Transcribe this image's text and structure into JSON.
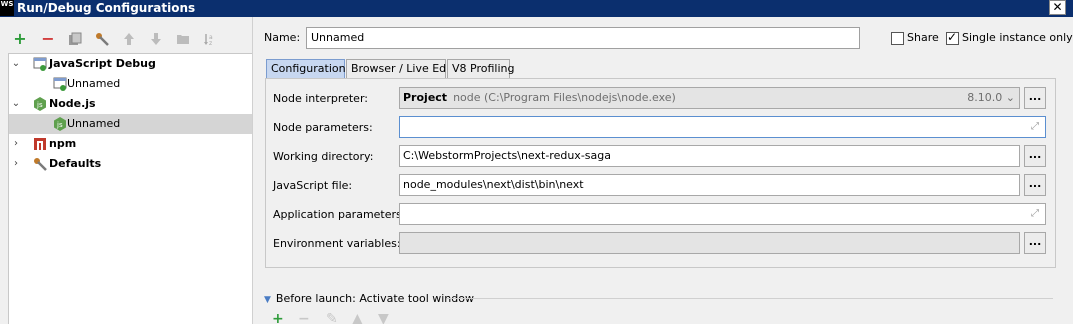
{
  "window": {
    "app_icon_text": "WS",
    "title": "Run/Debug Configurations",
    "close_symbol": "✕"
  },
  "toolbar": {
    "add": "+",
    "remove": "−",
    "icons": [
      "add-icon",
      "remove-icon",
      "copy-icon",
      "wrench-icon",
      "move-up-icon",
      "move-down-icon",
      "folder-icon",
      "sort-az-icon"
    ]
  },
  "tree": {
    "items": [
      {
        "label": "JavaScript Debug",
        "level": 0,
        "expanded": true,
        "bold": true
      },
      {
        "label": "Unnamed",
        "level": 1
      },
      {
        "label": "Node.js",
        "level": 0,
        "expanded": true,
        "bold": true
      },
      {
        "label": "Unnamed",
        "level": 1,
        "selected": true
      },
      {
        "label": "npm",
        "level": 0,
        "expanded": false,
        "bold": true
      },
      {
        "label": "Defaults",
        "level": 0,
        "expanded": false,
        "bold": true
      }
    ]
  },
  "header": {
    "name_label": "Name:",
    "name_value": "Unnamed",
    "share_label": "Share",
    "share_checked": false,
    "single_instance_label": "Single instance only",
    "single_instance_checked": true
  },
  "tabs": [
    {
      "label": "Configuration",
      "active": true
    },
    {
      "label": "Browser / Live Edit",
      "active": false
    },
    {
      "label": "V8 Profiling",
      "active": false
    }
  ],
  "form": {
    "node_interpreter_label": "Node interpreter:",
    "node_interpreter_kind": "Project",
    "node_interpreter_path": "node (C:\\Program Files\\nodejs\\node.exe)",
    "node_interpreter_version": "8.10.0",
    "node_parameters_label": "Node parameters:",
    "node_parameters_value": "",
    "working_directory_label": "Working directory:",
    "working_directory_value": "C:\\WebstormProjects\\next-redux-saga",
    "javascript_file_label": "JavaScript file:",
    "javascript_file_value": "node_modules\\next\\dist\\bin\\next",
    "application_parameters_label": "Application parameters:",
    "application_parameters_value": "",
    "environment_variables_label": "Environment variables:",
    "environment_variables_value": "",
    "browse_label": "..."
  },
  "before_launch": {
    "label": "Before launch: Activate tool window"
  },
  "colors": {
    "titlebar": "#0b2f6e",
    "active_tab": "#c7d7f0",
    "selection": "#d5d5d5",
    "add_green": "#2e9c3a",
    "remove_red": "#d23b3b"
  }
}
